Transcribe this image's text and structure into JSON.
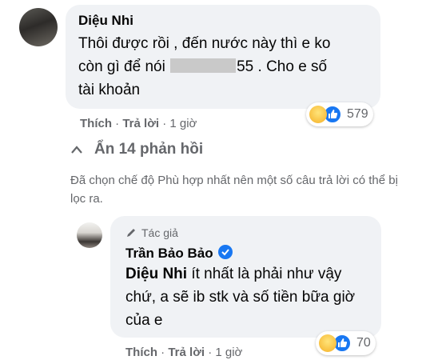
{
  "comment1": {
    "author": "Diệu Nhi",
    "text_before_redaction": "Thôi được rồi , đến nước này thì e ko còn gì để nói ",
    "text_after_redaction": "55 . Cho e số tài khoản",
    "reaction_count": "579",
    "reaction_icons": [
      "haha-icon",
      "like-icon"
    ],
    "actions": {
      "like": "Thích",
      "reply": "Trả lời",
      "time": "1 giờ",
      "sep": "·"
    }
  },
  "replies_toggle": "Ẩn 14 phản hồi",
  "filter_note": "Đã chọn chế độ Phù hợp nhất nên một số câu trả lời có thể bị lọc ra.",
  "comment2": {
    "author_badge": "Tác giả",
    "author": "Trần Bảo Bảo",
    "mention": "Diệu Nhi",
    "text": " ít nhất là phải như vậy chứ, a sẽ ib stk và số tiền bữa giờ của e",
    "reaction_count": "70",
    "reaction_icons": [
      "haha-icon",
      "like-icon"
    ],
    "actions": {
      "like": "Thích",
      "reply": "Trả lời",
      "time": "1 giờ",
      "sep": "·"
    }
  },
  "colors": {
    "bubble": "#f0f2f5",
    "secondary_text": "#65676b",
    "facebook_blue": "#1877f2"
  }
}
